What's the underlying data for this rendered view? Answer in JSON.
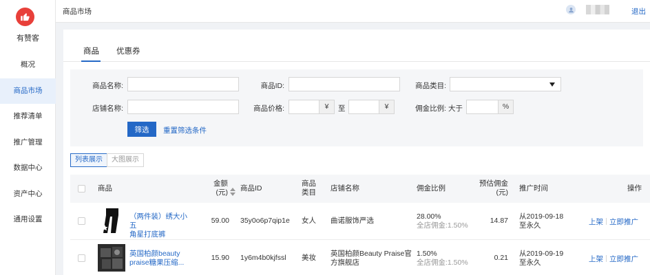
{
  "app": {
    "brand": "有赞客",
    "page_title": "商品市场",
    "logout": "退出"
  },
  "nav": [
    "概况",
    "商品市场",
    "推荐清单",
    "推广管理",
    "数据中心",
    "资产中心",
    "通用设置"
  ],
  "tabs": [
    "商品",
    "优惠券"
  ],
  "filter": {
    "product_name": "商品名称:",
    "product_id": "商品ID:",
    "category": "商品类目:",
    "shop_name": "店铺名称:",
    "price": "商品价格:",
    "yuan": "¥",
    "to": "至",
    "commission": "佣金比例:",
    "greater": "大于",
    "percent": "%",
    "filter_btn": "筛选",
    "reset": "重置筛选条件"
  },
  "view": {
    "list": "列表展示",
    "grid": "大图展示"
  },
  "table": {
    "headers": {
      "product": "商品",
      "amount_1": "金额",
      "amount_2": "(元)",
      "product_id": "商品ID",
      "category_1": "商品",
      "category_2": "类目",
      "shop": "店铺名称",
      "commission": "佣金比例",
      "est_1": "预估佣金",
      "est_2": "(元)",
      "time": "推广时间",
      "ops": "操作"
    },
    "rows": [
      {
        "name_1": "（两件装）绣大小五",
        "name_2": "角星打底裤",
        "amount": "59.00",
        "id": "35y0o6p7qip1e",
        "category": "女人",
        "shop_1": "曲诺服饰严选",
        "shop_2": "",
        "rate": "28.00%",
        "rate_all": "全店佣金:1.50%",
        "est": "14.87",
        "time_1": "从2019-09-18",
        "time_2": "至永久",
        "op_1": "上架",
        "op_2": "立即推广"
      },
      {
        "name_1": "英国柏颜beauty",
        "name_2": "praise糖果压缩...",
        "amount": "15.90",
        "id": "1y6m4b0kjfssl",
        "category": "美妆",
        "shop_1": "英国柏颜Beauty Praise官",
        "shop_2": "方旗舰店",
        "rate": "1.50%",
        "rate_all": "全店佣金:1.50%",
        "est": "0.21",
        "time_1": "从2019-09-19",
        "time_2": "至永久",
        "op_1": "上架",
        "op_2": "立即推广"
      }
    ]
  },
  "icons": {
    "logo": "thumbs-up-icon",
    "user": "user-icon",
    "caret": "caret-down-icon",
    "sort": "sort-icon"
  },
  "colors": {
    "primary": "#2468c6",
    "logo": "#e8403a"
  }
}
